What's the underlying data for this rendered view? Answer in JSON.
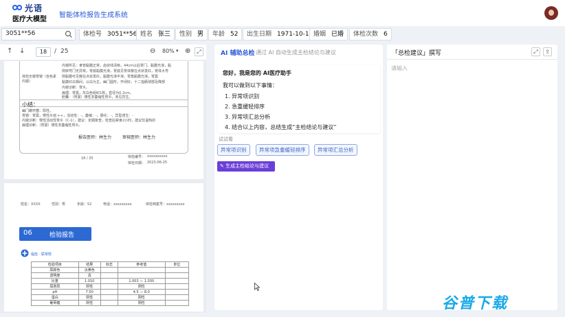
{
  "header": {
    "brand": "光语",
    "brand_sub": "医疗大模型",
    "system_title": "智能体检报告生成系统"
  },
  "infobar": {
    "search_value": "3051**56",
    "fields": [
      {
        "key": "体检号",
        "value": "3051**56"
      },
      {
        "key": "姓名",
        "value": "张三"
      },
      {
        "key": "性别",
        "value": "男"
      },
      {
        "key": "年龄",
        "value": "52"
      },
      {
        "key": "出生日期",
        "value": "1971-10-12"
      },
      {
        "key": "婚姻",
        "value": "已婚"
      },
      {
        "key": "体检次数",
        "value": "6"
      }
    ]
  },
  "viewer": {
    "current_page": "18",
    "separator": "/",
    "total_pages": "25",
    "zoom": "80%",
    "page1": {
      "row_label": "体检无镜胃镜（含色素内镜）",
      "row_text_1": "内镜所见：食管黏膜正常，齿状线清晰，44cm以后胃门。黏膜光滑，黏",
      "row_text_2": "侧转弯门无异常，胃底黏膜光滑，胃底见胃体散在点状发红，胃体大弯",
      "row_text_3": "侧黏膜可见散在点状发红，黏膜光滑平滑，胃角黏膜光滑，胃窦",
      "row_text_4": "黏膜红白相间，以白为主，幽门圆形，开闭好，十二指肠球部及降部",
      "row_text_5": "内镜诊断：胃炎。",
      "row_text_6": "病理：胃窦，灰白色组织1枚，直径为0.2cm。",
      "row_text_7": "胆囊：（胃窦）慢性非萎缩性胃炎，未见异生。",
      "summary_title": "小结：",
      "summary_1": "幽门螺杆菌：阳性。",
      "summary_2": "胃镜：胃窦，慢性炎症:++，活动性：-，萎缩：-，肠化：-，异型增生：-",
      "summary_3": "内镜诊断：慢性活动性胃炎（C-1），建议：定期复查，检查后禁食2小时，建议饮温热的",
      "summary_4": "病理诊断：（胃窦）慢性非萎缩性胃炎。",
      "doctor": "报告医师：林生力",
      "reviewer": "审核医师：林生力",
      "page_no": "18 / 25",
      "exam_no_label": "体检编号：",
      "exam_no_value": "xxxxxxxxxx",
      "exam_date_label": "体检日期：",
      "exam_date_value": "2023-06-25"
    },
    "page2": {
      "name": "姓名：XXXX",
      "gender": "性别：男",
      "age": "年龄：52",
      "phone": "电话：xxxxxxxxx",
      "archive": "体检档案号：xxxxxxxxx",
      "section_no": "06",
      "section_title": "检验报告",
      "lab_group": "临检 · 尿常规",
      "table_headers": [
        "检验项目",
        "结果",
        "标志",
        "参考值",
        "单位"
      ],
      "table_rows": [
        [
          "尿颜色",
          "淡黄色",
          "",
          "",
          ""
        ],
        [
          "透明度",
          "清",
          "",
          "",
          ""
        ],
        [
          "比重",
          "1.010",
          "",
          "1.003 — 1.030",
          ""
        ],
        [
          "尿胆原",
          "阴性",
          "",
          "阴性",
          ""
        ],
        [
          "pH",
          "7.50",
          "",
          "4.5 — 8.0",
          ""
        ],
        [
          "蛋白",
          "阴性",
          "",
          "阴性",
          ""
        ],
        [
          "葡萄糖",
          "阴性",
          "",
          "阴性",
          ""
        ]
      ]
    }
  },
  "ai": {
    "title": "AI 辅助总检",
    "subtitle": "通过 AI 自动生成主检结论与建议",
    "greeting": "您好，我是您的 AI医疗助手",
    "intro": "我可以做到以下事情：",
    "items": [
      "1. 异常项识别",
      "2. 急重缓轻排序",
      "3. 异常项汇总分析",
      "4. 结合以上内容，总结生成“主检结论与建议”"
    ],
    "try_label": "试试看",
    "chips": [
      "异常项识别",
      "异常项急重缓轻排序",
      "异常项汇总分析"
    ],
    "generate_label": "生成主检结论与建议"
  },
  "editor": {
    "title": "「总检建议」撰写",
    "placeholder": "请输入"
  },
  "watermark": "谷普下载"
}
